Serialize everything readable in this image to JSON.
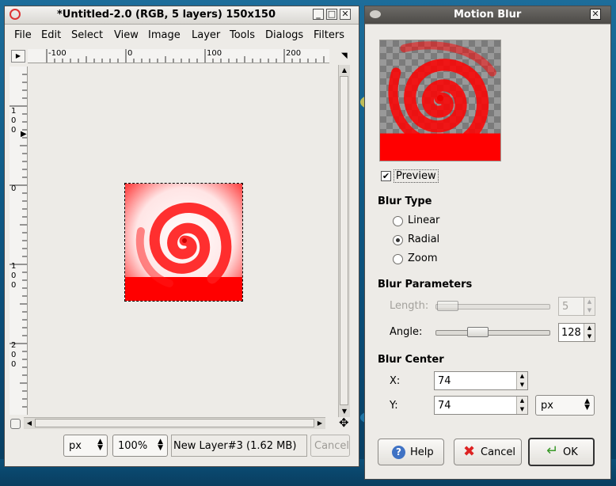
{
  "image_window": {
    "title": "*Untitled-2.0 (RGB, 5 layers) 150x150",
    "menu": [
      "File",
      "Edit",
      "Select",
      "View",
      "Image",
      "Layer",
      "Tools",
      "Dialogs",
      "Filters"
    ],
    "ruler_h": [
      "-100",
      "0",
      "100",
      "200"
    ],
    "ruler_v_left": [
      "1",
      "0",
      "0"
    ],
    "ruler_v_zero": "0",
    "ruler_v_100": [
      "1",
      "0",
      "0"
    ],
    "ruler_v_200": [
      "2",
      "0",
      "0"
    ],
    "status": {
      "unit": "px",
      "zoom": "100%",
      "layer_info": "New Layer#3 (1.62 MB)",
      "cancel_label": "Cancel"
    }
  },
  "dialog": {
    "title": "Motion Blur",
    "preview_label": "Preview",
    "preview_checked": true,
    "blur_type": {
      "heading": "Blur Type",
      "options": [
        "Linear",
        "Radial",
        "Zoom"
      ],
      "selected": "Radial"
    },
    "blur_parameters": {
      "heading": "Blur Parameters",
      "length_label": "Length:",
      "length_value": "5",
      "length_enabled": false,
      "angle_label": "Angle:",
      "angle_value": "128"
    },
    "blur_center": {
      "heading": "Blur Center",
      "x_label": "X:",
      "x_value": "74",
      "y_label": "Y:",
      "y_value": "74",
      "unit": "px"
    },
    "buttons": {
      "help": "Help",
      "cancel": "Cancel",
      "ok": "OK"
    }
  },
  "colors": {
    "swirl_red": "#ff0000",
    "active_title": "#55524f",
    "desktop": "#0f5c88"
  },
  "icons": [
    "gimp-icon",
    "minimize-icon",
    "maximize-icon",
    "close-icon",
    "navigate-icon",
    "quickmask-icon",
    "move-icon",
    "help-icon",
    "cancel-icon",
    "ok-icon"
  ]
}
